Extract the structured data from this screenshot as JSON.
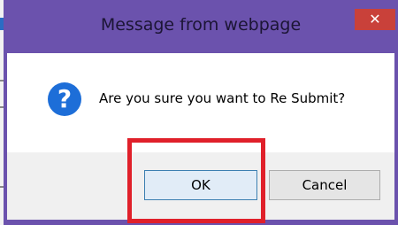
{
  "dialog": {
    "title": "Message from webpage",
    "close_glyph": "✕",
    "icon": "question-icon",
    "icon_glyph": "?",
    "message": "Are you sure you want to Re Submit?",
    "buttons": {
      "ok": "OK",
      "cancel": "Cancel"
    }
  },
  "colors": {
    "frame": "#6b52ad",
    "close": "#c9413a",
    "highlight": "#e0202a",
    "icon": "#1d6ed8"
  }
}
